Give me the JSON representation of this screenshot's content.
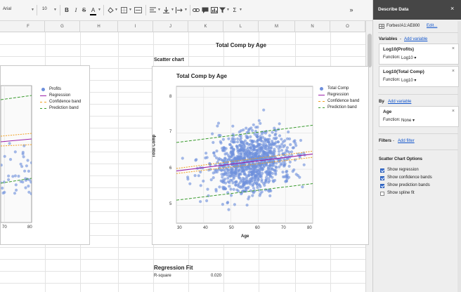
{
  "toolbar": {
    "font": "Arial",
    "font_size": "10",
    "bold": "B",
    "italic": "I",
    "strike": "S",
    "text_color": "A",
    "sigma": "Σ",
    "collapse": "»"
  },
  "columns": [
    "F",
    "G",
    "H",
    "I",
    "J",
    "K",
    "L",
    "M",
    "N",
    "O"
  ],
  "sheet": {
    "big_title": "Total Comp by Age",
    "scatter_title": "Scatter chart",
    "regression_title": "Regression Fit",
    "rsquare_label": "R-square",
    "rsquare_value": "0.020"
  },
  "chart_data": [
    {
      "type": "scatter",
      "title": "Total Comp by Age",
      "xlabel": "Age",
      "ylabel": "Total Comp",
      "xlim": [
        30,
        80
      ],
      "ylim": [
        4.5,
        8.3
      ],
      "xticks": [
        "30",
        "40",
        "50",
        "60",
        "70",
        "80"
      ],
      "yticks": [
        "5",
        "6",
        "7",
        "8"
      ],
      "legend_position": "right",
      "grid": true,
      "series": [
        {
          "name": "Total Comp",
          "kind": "points",
          "color": "#6e8fdc",
          "approx_center": [
            57,
            6.1
          ],
          "approx_count": 1000
        },
        {
          "name": "Regression",
          "kind": "line",
          "color": "#9b1fa8",
          "x": [
            30,
            80
          ],
          "y": [
            5.95,
            6.42
          ]
        },
        {
          "name": "Confidence band",
          "kind": "dashed",
          "color": "#f0a020",
          "upper": [
            [
              30,
              6.02
            ],
            [
              80,
              6.5
            ]
          ],
          "lower": [
            [
              30,
              5.88
            ],
            [
              80,
              6.33
            ]
          ]
        },
        {
          "name": "Prediction band",
          "kind": "dashed",
          "color": "#3a9b2e",
          "upper": [
            [
              30,
              6.74
            ],
            [
              80,
              7.22
            ]
          ],
          "lower": [
            [
              30,
              5.14
            ],
            [
              80,
              5.6
            ]
          ]
        }
      ]
    },
    {
      "type": "scatter",
      "title": "",
      "xticks": [
        "70",
        "80"
      ],
      "legend_position": "right",
      "series": [
        {
          "name": "Profits",
          "kind": "points",
          "color": "#6e8fdc"
        },
        {
          "name": "Regression",
          "kind": "line",
          "color": "#9b1fa8"
        },
        {
          "name": "Confidence band",
          "kind": "dashed",
          "color": "#f0a020"
        },
        {
          "name": "Prediction band",
          "kind": "dashed",
          "color": "#3a9b2e"
        }
      ]
    }
  ],
  "panel": {
    "title": "Describe Data",
    "close": "×",
    "range": "Forbes!A1:AE800",
    "edit_link": "Edit...",
    "variables_label": "Variables",
    "add_variable": "Add variable",
    "variables": [
      {
        "name": "Log10(Profits)",
        "function_label": "Function:",
        "function_value": "Log10"
      },
      {
        "name": "Log10(Total Comp)",
        "function_label": "Function:",
        "function_value": "Log10"
      }
    ],
    "by_label": "By",
    "by_variable": {
      "name": "Age",
      "function_label": "Function:",
      "function_value": "None"
    },
    "filters_label": "Filters",
    "add_filter": "Add filter",
    "options_label": "Scatter Chart Options",
    "options": [
      {
        "label": "Show regression",
        "checked": true
      },
      {
        "label": "Show confidence bands",
        "checked": true
      },
      {
        "label": "Show prediction bands",
        "checked": true
      },
      {
        "label": "Show spline fit",
        "checked": false
      }
    ],
    "separator": " - ",
    "remove": "×",
    "caret": "▾"
  },
  "colors": {
    "points": "#6e8fdc",
    "regression": "#9b1fa8",
    "confidence": "#f0a020",
    "prediction": "#3a9b2e",
    "panel_header": "#464646",
    "link": "#1155cc"
  }
}
